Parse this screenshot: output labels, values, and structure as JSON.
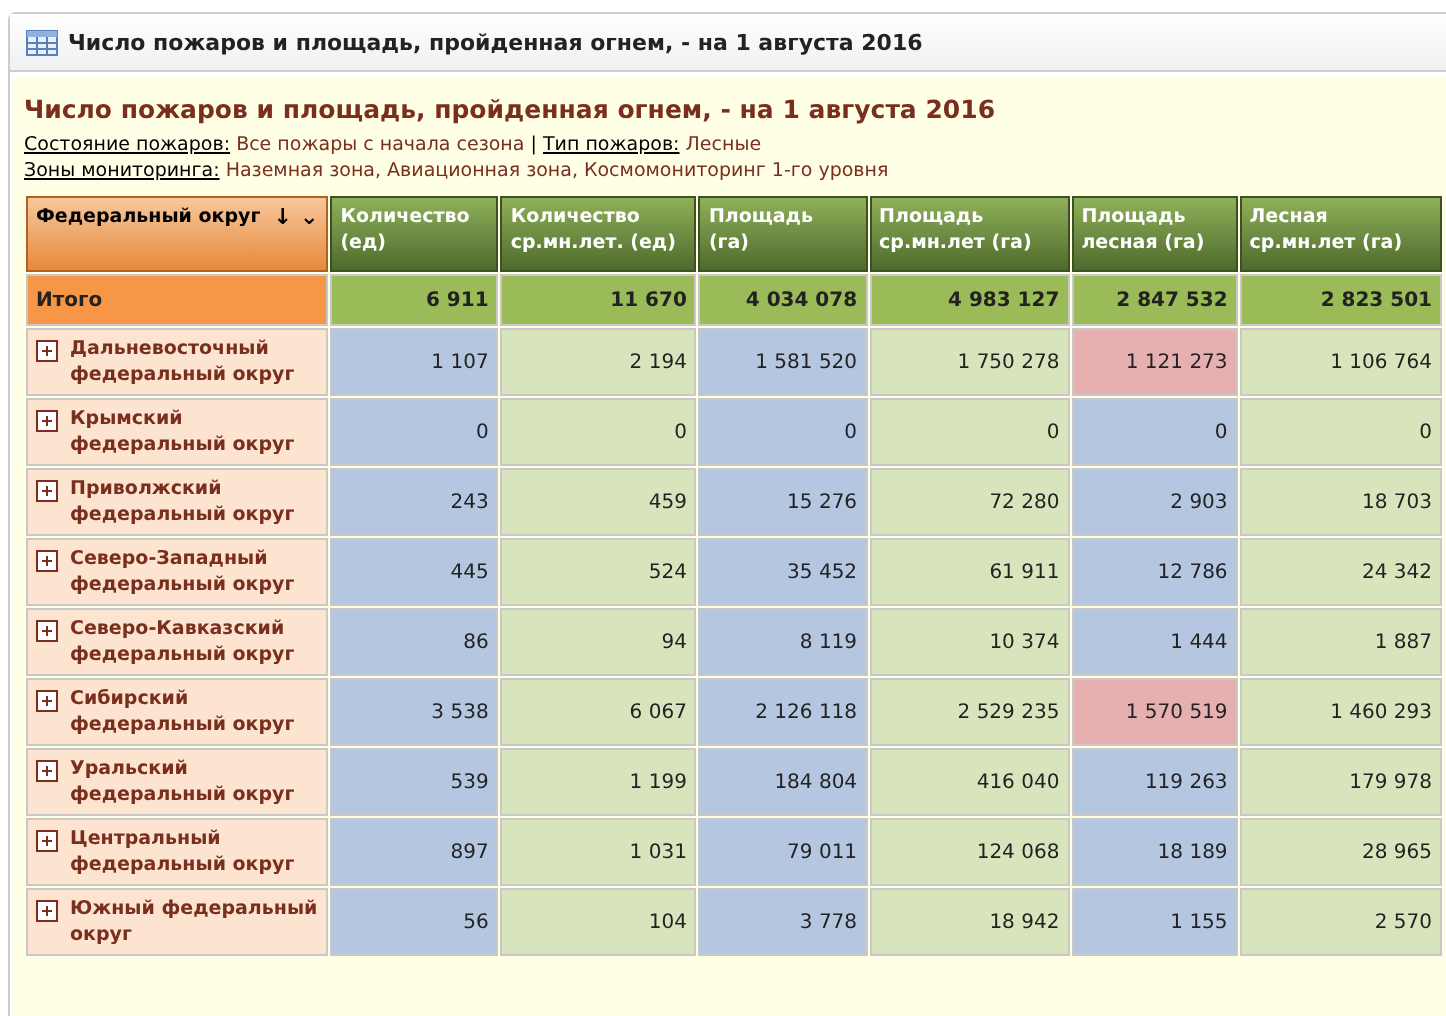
{
  "window": {
    "title": "Число пожаров и площадь, пройденная огнем, - на 1 августа 2016"
  },
  "report": {
    "heading": "Число пожаров и площадь, пройденная огнем, - на 1 августа 2016",
    "filters": [
      [
        {
          "label": "Состояние пожаров:",
          "value": "Все пожары с начала сезона"
        },
        {
          "separator": "|",
          "label": "Тип пожаров:",
          "value": "Лесные"
        }
      ],
      [
        {
          "label": "Зоны мониторинга:",
          "value": "Наземная зона, Авиационная зона, Космомониторинг 1-го уровня"
        }
      ]
    ]
  },
  "table": {
    "row_header": {
      "label": "Федеральный округ",
      "sort": "↓",
      "menu": "⌄"
    },
    "columns": [
      {
        "label": "Количество (ед)"
      },
      {
        "label": "Количество ср.мн.лет. (ед)"
      },
      {
        "label": "Площадь (га)"
      },
      {
        "label": "Площадь ср.мн.лет (га)"
      },
      {
        "label": "Площадь лесная (га)"
      },
      {
        "label": "Лесная ср.мн.лет (га)"
      }
    ],
    "total": {
      "label": "Итого",
      "values": [
        "6 911",
        "11 670",
        "4 034 078",
        "4 983 127",
        "2 847 532",
        "2 823 501"
      ]
    },
    "rows": [
      {
        "label": "Дальневосточный федеральный округ",
        "expanded": false,
        "cells": [
          {
            "text": "1 107",
            "color": "#b4c6e0"
          },
          {
            "text": "2 194",
            "color": "#d8e4bc"
          },
          {
            "text": "1 581 520",
            "color": "#b4c6e0"
          },
          {
            "text": "1 750 278",
            "color": "#d8e4bc"
          },
          {
            "text": "1 121 273",
            "color": "#e6b0b0"
          },
          {
            "text": "1 106 764",
            "color": "#d8e4bc"
          }
        ]
      },
      {
        "label": "Крымский федеральный округ",
        "expanded": false,
        "cells": [
          {
            "text": "0",
            "color": "#b4c6e0"
          },
          {
            "text": "0",
            "color": "#d8e4bc"
          },
          {
            "text": "0",
            "color": "#b4c6e0"
          },
          {
            "text": "0",
            "color": "#d8e4bc"
          },
          {
            "text": "0",
            "color": "#b4c6e0"
          },
          {
            "text": "0",
            "color": "#d8e4bc"
          }
        ]
      },
      {
        "label": "Приволжский федеральный округ",
        "expanded": false,
        "cells": [
          {
            "text": "243",
            "color": "#b4c6e0"
          },
          {
            "text": "459",
            "color": "#d8e4bc"
          },
          {
            "text": "15 276",
            "color": "#b4c6e0"
          },
          {
            "text": "72 280",
            "color": "#d8e4bc"
          },
          {
            "text": "2 903",
            "color": "#b4c6e0"
          },
          {
            "text": "18 703",
            "color": "#d8e4bc"
          }
        ]
      },
      {
        "label": "Северо-Западный федеральный округ",
        "expanded": false,
        "cells": [
          {
            "text": "445",
            "color": "#b4c6e0"
          },
          {
            "text": "524",
            "color": "#d8e4bc"
          },
          {
            "text": "35 452",
            "color": "#b4c6e0"
          },
          {
            "text": "61 911",
            "color": "#d8e4bc"
          },
          {
            "text": "12 786",
            "color": "#b4c6e0"
          },
          {
            "text": "24 342",
            "color": "#d8e4bc"
          }
        ]
      },
      {
        "label": "Северо-Кавказский федеральный округ",
        "expanded": false,
        "cells": [
          {
            "text": "86",
            "color": "#b4c6e0"
          },
          {
            "text": "94",
            "color": "#d8e4bc"
          },
          {
            "text": "8 119",
            "color": "#b4c6e0"
          },
          {
            "text": "10 374",
            "color": "#d8e4bc"
          },
          {
            "text": "1 444",
            "color": "#b4c6e0"
          },
          {
            "text": "1 887",
            "color": "#d8e4bc"
          }
        ]
      },
      {
        "label": "Сибирский федеральный округ",
        "expanded": false,
        "cells": [
          {
            "text": "3 538",
            "color": "#b4c6e0"
          },
          {
            "text": "6 067",
            "color": "#d8e4bc"
          },
          {
            "text": "2 126 118",
            "color": "#b4c6e0"
          },
          {
            "text": "2 529 235",
            "color": "#d8e4bc"
          },
          {
            "text": "1 570 519",
            "color": "#e6b0b0"
          },
          {
            "text": "1 460 293",
            "color": "#d8e4bc"
          }
        ]
      },
      {
        "label": "Уральский федеральный округ",
        "expanded": false,
        "cells": [
          {
            "text": "539",
            "color": "#b4c6e0"
          },
          {
            "text": "1 199",
            "color": "#d8e4bc"
          },
          {
            "text": "184 804",
            "color": "#b4c6e0"
          },
          {
            "text": "416 040",
            "color": "#d8e4bc"
          },
          {
            "text": "119 263",
            "color": "#b4c6e0"
          },
          {
            "text": "179 978",
            "color": "#d8e4bc"
          }
        ]
      },
      {
        "label": "Центральный федеральный округ",
        "expanded": false,
        "cells": [
          {
            "text": "897",
            "color": "#b4c6e0"
          },
          {
            "text": "1 031",
            "color": "#d8e4bc"
          },
          {
            "text": "79 011",
            "color": "#b4c6e0"
          },
          {
            "text": "124 068",
            "color": "#d8e4bc"
          },
          {
            "text": "18 189",
            "color": "#b4c6e0"
          },
          {
            "text": "28 965",
            "color": "#d8e4bc"
          }
        ]
      },
      {
        "label": "Южный федеральный округ",
        "expanded": false,
        "cells": [
          {
            "text": "56",
            "color": "#b4c6e0"
          },
          {
            "text": "104",
            "color": "#d8e4bc"
          },
          {
            "text": "3 778",
            "color": "#b4c6e0"
          },
          {
            "text": "18 942",
            "color": "#d8e4bc"
          },
          {
            "text": "1 155",
            "color": "#b4c6e0"
          },
          {
            "text": "2 570",
            "color": "#d8e4bc"
          }
        ]
      }
    ]
  }
}
